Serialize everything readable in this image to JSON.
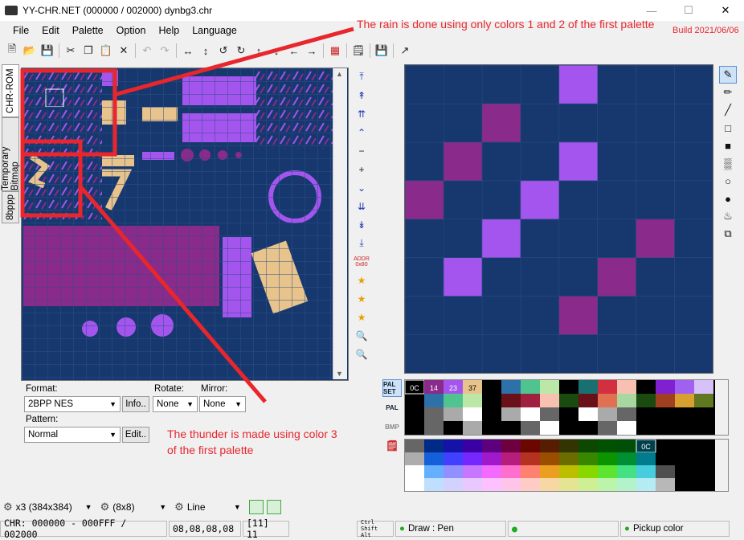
{
  "window": {
    "title": "YY-CHR.NET (000000 / 002000) dynbg3.chr",
    "build": "Build 2021/06/06"
  },
  "menu": [
    "File",
    "Edit",
    "Palette",
    "Option",
    "Help",
    "Language"
  ],
  "tabs": {
    "chr_rom": "CHR-ROM",
    "temporary_bitmap": "Temporary Bitmap",
    "bpp8": "8bppp"
  },
  "format": {
    "format_label": "Format:",
    "format_value": "2BPP NES",
    "info_button": "Info..",
    "rotate_label": "Rotate:",
    "rotate_value": "None",
    "mirror_label": "Mirror:",
    "mirror_value": "None",
    "pattern_label": "Pattern:",
    "pattern_value": "Normal",
    "edit_button": "Edit.."
  },
  "palette_tabs": {
    "palset": "PAL SET",
    "pal": "PAL",
    "bmp": "BMP"
  },
  "palette_row0": [
    "0C",
    "14",
    "23",
    "37"
  ],
  "nes_palette_selected": "0C",
  "bottom": {
    "zoom": "x3 (384x384)",
    "grid": "(8x8)",
    "tool": "Line"
  },
  "status": {
    "chr_range": "CHR: 000000 - 000FFF / 002000",
    "bytes": "08,08,08,08",
    "index": "[11] 11",
    "draw_mode": "Draw : Pen",
    "pickup": "Pickup color"
  },
  "annotations": {
    "rain": "The rain is done using only colors 1 and 2 of the first palette",
    "thunder_line1": "The thunder is made using color 3",
    "thunder_line2": "of the first palette"
  },
  "colors": {
    "bg": "#17386e",
    "dark_purple": "#8a2a8a",
    "light_purple": "#a455ee",
    "tan": "#e8c48c",
    "annotation": "#e8262c"
  }
}
